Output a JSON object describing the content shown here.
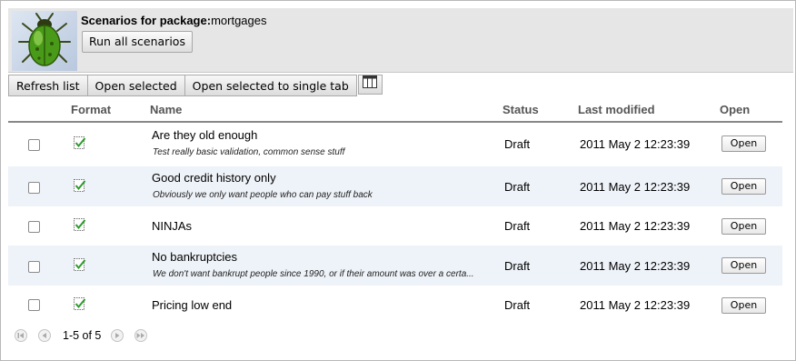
{
  "header": {
    "package_label": "Scenarios for package:",
    "package_name": "mortgages",
    "run_all_label": "Run all scenarios",
    "logo_icon": "bug-logo-icon"
  },
  "toolbar": {
    "refresh_label": "Refresh list",
    "open_selected_label": "Open selected",
    "open_single_tab_label": "Open selected to single tab",
    "columns_icon": "columns-icon"
  },
  "table": {
    "columns": {
      "format": "Format",
      "name": "Name",
      "status": "Status",
      "modified": "Last modified",
      "open": "Open"
    },
    "rows": [
      {
        "name": "Are they old enough",
        "description": "Test really basic validation, common sense stuff",
        "status": "Draft",
        "modified": "2011 May 2 12:23:39",
        "open_label": "Open"
      },
      {
        "name": "Good credit history only",
        "description": "Obviously we only want people who can pay stuff back",
        "status": "Draft",
        "modified": "2011 May 2 12:23:39",
        "open_label": "Open"
      },
      {
        "name": "NINJAs",
        "description": "",
        "status": "Draft",
        "modified": "2011 May 2 12:23:39",
        "open_label": "Open"
      },
      {
        "name": "No bankruptcies",
        "description": "We don't want bankrupt people since 1990, or if their amount was over a certa...",
        "status": "Draft",
        "modified": "2011 May 2 12:23:39",
        "open_label": "Open"
      },
      {
        "name": "Pricing low end",
        "description": "",
        "status": "Draft",
        "modified": "2011 May 2 12:23:39",
        "open_label": "Open"
      }
    ]
  },
  "pager": {
    "range_text": "1-5 of 5"
  },
  "colors": {
    "header_bg": "#e6e6e6",
    "row_alt_bg": "#eef3f9",
    "check_green": "#2e9a2e"
  }
}
